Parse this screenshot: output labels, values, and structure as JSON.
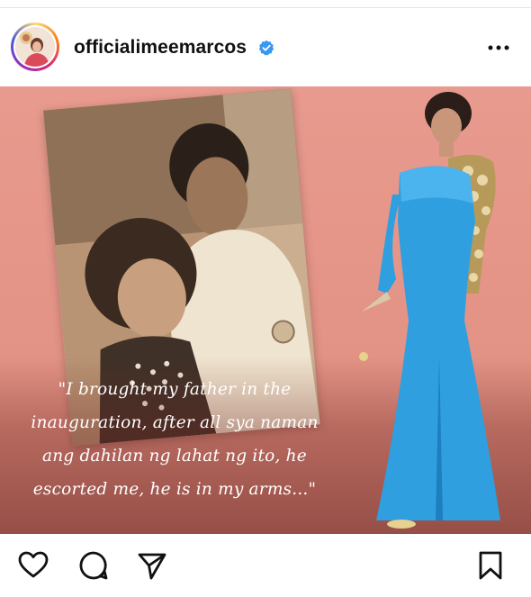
{
  "post": {
    "username": "officialimeemarcos",
    "quote_lines": [
      "\"I brought my father in the",
      "inauguration, after all sya naman",
      "ang dahilan ng lahat ng ito, he",
      "escorted me, he is in my arms...\""
    ]
  },
  "icons": {
    "verified": "verified-badge-icon",
    "more": "more-options-icon",
    "like": "heart-icon",
    "comment": "comment-icon",
    "share": "send-icon",
    "save": "bookmark-icon"
  },
  "colors": {
    "post_bg": "#e39385",
    "verified_blue": "#3897f0",
    "gown_blue": "#2f9fe0",
    "quote_text": "#ffffff"
  }
}
